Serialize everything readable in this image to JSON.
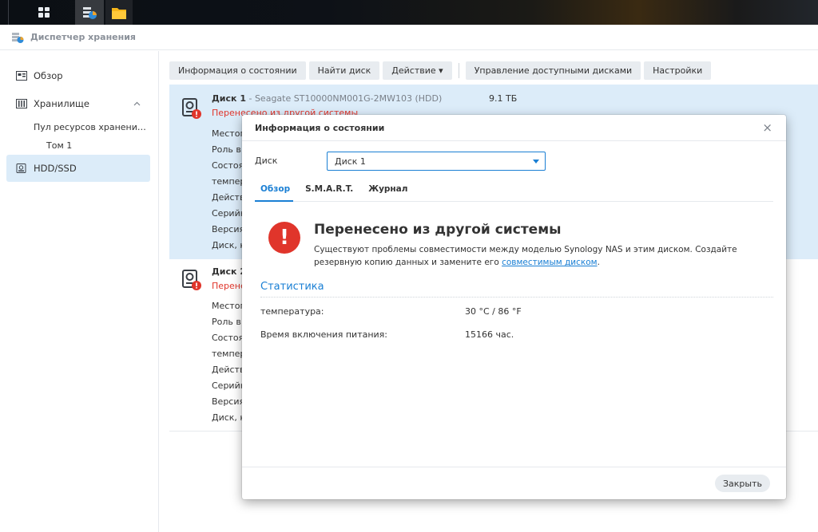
{
  "app": {
    "title": "Диспетчер хранения"
  },
  "sidebar": {
    "overview": "Обзор",
    "storage": "Хранилище",
    "pool": "Пул ресурсов хранени…",
    "volume": "Том 1",
    "hdd": "HDD/SSD"
  },
  "toolbar": {
    "health_info": "Информация о состоянии",
    "find_disk": "Найти диск",
    "action": "Действие ▾",
    "manage_disks": "Управление доступными дисками",
    "settings": "Настройки"
  },
  "disks": [
    {
      "name": "Диск 1",
      "model": " - Seagate ST10000NM001G-2MW103 (HDD)",
      "size": "9.1 ТБ",
      "status": "Перенесено из другой системы",
      "props": [
        "Местоп",
        "Роль в",
        "Состоя",
        "темпер",
        "Действ",
        "Серийн",
        "Версия",
        "Диск, к"
      ]
    },
    {
      "name": "Диск 2",
      "status": "Перенесено из другой системы",
      "props": [
        "Местоп",
        "Роль в",
        "Состоя",
        "темпер",
        "Действ",
        "Серийн",
        "Версия",
        "Диск, к"
      ]
    }
  ],
  "modal": {
    "title": "Информация о состоянии",
    "close": "×",
    "disk_label": "Диск",
    "disk_value": "Диск 1",
    "tabs": [
      "Обзор",
      "S.M.A.R.T.",
      "Журнал"
    ],
    "warning_title": "Перенесено из другой системы",
    "warning_text": "Существуют проблемы совместимости между моделью Synology NAS и этим диском. Создайте резервную копию данных и замените его ",
    "warning_link": "совместимым диском",
    "warning_end": ".",
    "stats_title": "Статистика",
    "stats": [
      {
        "key": "температура:",
        "value": "30 °C / 86 °F"
      },
      {
        "key": "Время включения питания:",
        "value": "15166 час."
      }
    ],
    "close_button": "Закрыть"
  },
  "colors": {
    "accent": "#1a7fd4",
    "error": "#e0352b",
    "selection": "#dcecf9"
  }
}
